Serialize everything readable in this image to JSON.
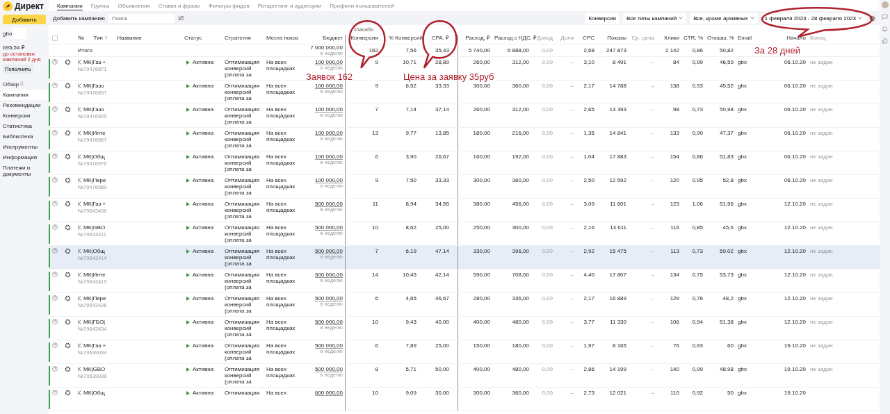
{
  "logo": "Директ",
  "nav_tabs": [
    {
      "label": "Кампании",
      "selected": true
    },
    {
      "label": "Группы",
      "selected": false
    },
    {
      "label": "Объявления",
      "selected": false
    },
    {
      "label": "Ставки и фразы",
      "selected": false
    },
    {
      "label": "Фильтры фидов",
      "selected": false
    },
    {
      "label": "Ретаргетинг и аудитории",
      "selected": false
    },
    {
      "label": "Профили пользователей",
      "selected": false
    }
  ],
  "sidebar": {
    "add_button": "Добавить",
    "account": "gbo",
    "balance": "695,54 ₽",
    "warning": "до остановки кампаний 2 дня",
    "topup_button": "Пополнить",
    "items": [
      {
        "label": "Обзор",
        "selected": false
      },
      {
        "label": "Кампании",
        "selected": true
      },
      {
        "label": "Рекомендации",
        "selected": false
      },
      {
        "label": "Конверсии",
        "selected": false
      },
      {
        "label": "Статистика",
        "selected": false
      },
      {
        "label": "Библиотека",
        "selected": false
      },
      {
        "label": "Инструменты",
        "selected": false
      },
      {
        "label": "Информация",
        "selected": false
      },
      {
        "label": "Платежи и документы",
        "selected": false
      }
    ]
  },
  "toolbar": {
    "add_campaign": "Добавить кампанию",
    "search": {
      "placeholder": "Поиск"
    },
    "filters": [
      {
        "label": "Конверсии",
        "kind": "button"
      },
      {
        "label": "Все типы кампаний",
        "kind": "dropdown"
      },
      {
        "label": "Все, кроме архивных",
        "kind": "dropdown"
      },
      {
        "label": "1 февраля 2023 - 28 февраля 2023",
        "kind": "dropdown"
      }
    ]
  },
  "table": {
    "goal": "спасибо",
    "columns": [
      "№",
      "Тип ↑",
      "Название",
      "Статус",
      "Стратегия",
      "Места показ",
      "Бюджет",
      "Конверсии",
      "% Конверсий",
      "CPA, ₽",
      "Расход, ₽",
      "Расход с НДС, ₽",
      "Доход",
      "Доля",
      "CPC",
      "Показы",
      "Ср. цена",
      "Клики",
      "CTR, %",
      "Отказы, %",
      "Email",
      "Начало",
      "Конец"
    ],
    "select_all": {
      "checked": false
    },
    "total": {
      "label": "Итого",
      "budget": "7 000 000,00",
      "budget_note": "в неделю",
      "conversions": "162",
      "conversion_rate": "7,56",
      "cpa": "35,43",
      "spend": "5 740,00",
      "spend_vat": "6 888,00",
      "income": "0,00",
      "cpc": "2,68",
      "impressions": "247 873",
      "clicks": "2 142",
      "ctr": "0,86",
      "bounce_rate": "50,82"
    },
    "rows": [
      {
        "name": "МК|Газ +",
        "number": "№79476871",
        "status": "Активна",
        "strategy": "Оптимизация конверсий (оплата за",
        "places": "На всех площадках",
        "budget": "100 000,00",
        "budget_note": "в неделю",
        "highlighted": false,
        "values": [
          "9",
          "10,71",
          "28,89",
          "260,00",
          "312,00",
          "0,00",
          "–",
          "3,10",
          "8 491",
          "–",
          "84",
          "0,99",
          "46,59",
          "gbx",
          "06.10.20",
          "не задан"
        ]
      },
      {
        "name": "МК|Газо",
        "number": "№79476897",
        "status": "Активна",
        "strategy": "Оптимизация конверсий (оплата за",
        "places": "На всех площадках",
        "budget": "100 000,00",
        "budget_note": "в неделю",
        "highlighted": false,
        "values": [
          "9",
          "6,52",
          "33,33",
          "300,00",
          "360,00",
          "0,00",
          "–",
          "2,17",
          "14 788",
          "–",
          "138",
          "0,93",
          "45,52",
          "gbx",
          "06.10.20",
          "не задан"
        ]
      },
      {
        "name": "МК|Газо",
        "number": "№79476925",
        "status": "Активна",
        "strategy": "Оптимизация конверсий (оплата за",
        "places": "На всех площадках",
        "budget": "100 000,00",
        "budget_note": "в неделю",
        "highlighted": false,
        "values": [
          "7",
          "7,14",
          "37,14",
          "260,00",
          "312,00",
          "0,00",
          "–",
          "2,65",
          "13 393",
          "–",
          "98",
          "0,73",
          "50,98",
          "gbx",
          "06.10.20",
          "не задан"
        ]
      },
      {
        "name": "МК|Инте",
        "number": "№79476957",
        "status": "Активна",
        "strategy": "Оптимизация конверсий (оплата за",
        "places": "На всех площадках",
        "budget": "100 000,00",
        "budget_note": "в неделю",
        "highlighted": false,
        "values": [
          "13",
          "9,77",
          "13,85",
          "180,00",
          "216,00",
          "0,00",
          "–",
          "1,35",
          "14 841",
          "–",
          "133",
          "0,90",
          "47,37",
          "gbx",
          "06.10.20",
          "не задан"
        ]
      },
      {
        "name": "МК|Общ",
        "number": "№79476976",
        "status": "Активна",
        "strategy": "Оптимизация конверсий (оплата за",
        "places": "На всех площадках",
        "budget": "100 000,00",
        "budget_note": "в неделю",
        "highlighted": false,
        "values": [
          "6",
          "3,90",
          "26,67",
          "160,00",
          "192,00",
          "0,00",
          "–",
          "1,04",
          "17 883",
          "–",
          "154",
          "0,86",
          "51,83",
          "gbx",
          "06.10.20",
          "не задан"
        ]
      },
      {
        "name": "МК|Пере",
        "number": "№79476989",
        "status": "Активна",
        "strategy": "Оптимизация конверсий (оплата за",
        "places": "На всех площадках",
        "budget": "100 000,00",
        "budget_note": "в неделю",
        "highlighted": false,
        "values": [
          "9",
          "7,50",
          "33,33",
          "300,00",
          "360,00",
          "0,00",
          "–",
          "2,50",
          "12 592",
          "–",
          "120",
          "0,95",
          "52,8",
          "gbx",
          "06.10.20",
          "не задан"
        ]
      },
      {
        "name": "МК|Газ +",
        "number": "№79643406",
        "status": "Активна",
        "strategy": "Оптимизация конверсий (оплата за",
        "places": "На всех площадках",
        "budget": "500 000,00",
        "budget_note": "в неделю",
        "highlighted": false,
        "values": [
          "11",
          "8,94",
          "34,55",
          "380,00",
          "456,00",
          "0,00",
          "–",
          "3,09",
          "11 601",
          "–",
          "123",
          "1,06",
          "51,56",
          "gbx",
          "12.10.20",
          "не задан"
        ]
      },
      {
        "name": "МК|GBO",
        "number": "№79643411",
        "status": "Активна",
        "strategy": "Оптимизация конверсий (оплата за",
        "places": "На всех площадках",
        "budget": "500 000,00",
        "budget_note": "в неделю",
        "highlighted": false,
        "values": [
          "10",
          "8,62",
          "25,00",
          "250,00",
          "300,00",
          "0,00",
          "–",
          "2,16",
          "13 611",
          "–",
          "116",
          "0,85",
          "45,6",
          "gbx",
          "12.10.20",
          "не задан"
        ]
      },
      {
        "name": "МК|Общ",
        "number": "№79643414",
        "status": "Активна",
        "strategy": "Оптимизация конверсий (оплата за",
        "places": "На всех площадках",
        "budget": "500 000,00",
        "budget_note": "в неделю",
        "highlighted": true,
        "values": [
          "7",
          "6,19",
          "47,14",
          "330,00",
          "396,00",
          "0,00",
          "–",
          "2,92",
          "15 475",
          "–",
          "113",
          "0,73",
          "59,02",
          "gbx",
          "12.10.20",
          "не задан"
        ]
      },
      {
        "name": "МК|Инте",
        "number": "№79643419",
        "status": "Активна",
        "strategy": "Оптимизация конверсий (оплата за",
        "places": "На всех площадках",
        "budget": "500 000,00",
        "budget_note": "в неделю",
        "highlighted": false,
        "values": [
          "14",
          "10,45",
          "42,14",
          "590,00",
          "708,00",
          "0,00",
          "–",
          "4,40",
          "17 807",
          "–",
          "134",
          "0,75",
          "53,73",
          "gbx",
          "12.10.20",
          "не задан"
        ]
      },
      {
        "name": "МК|Пере",
        "number": "№79643426",
        "status": "Активна",
        "strategy": "Оптимизация конверсий (оплата за",
        "places": "На всех площадках",
        "budget": "500 000,00",
        "budget_note": "в неделю",
        "highlighted": false,
        "values": [
          "6",
          "4,65",
          "46,67",
          "280,00",
          "336,00",
          "0,00",
          "–",
          "2,17",
          "16 889",
          "–",
          "129",
          "0,76",
          "48,2",
          "gbx",
          "12.10.20",
          "не задан"
        ]
      },
      {
        "name": "МК|ГБО|",
        "number": "№79643434",
        "status": "Активна",
        "strategy": "Оптимизация конверсий (оплата за",
        "places": "На всех площадках",
        "budget": "500 000,00",
        "budget_note": "в неделю",
        "highlighted": false,
        "values": [
          "10",
          "9,43",
          "40,00",
          "400,00",
          "480,00",
          "0,00",
          "–",
          "3,77",
          "11 330",
          "–",
          "106",
          "0,94",
          "51,38",
          "gbx",
          "12.10.20",
          "не задан"
        ]
      },
      {
        "name": "МК|Газ +",
        "number": "№79639034",
        "status": "Активна",
        "strategy": "Оптимизация конверсий (оплата за",
        "places": "На всех площадках",
        "budget": "500 000,00",
        "budget_note": "в неделю",
        "highlighted": false,
        "values": [
          "6",
          "7,89",
          "25,00",
          "150,00",
          "180,00",
          "0,00",
          "–",
          "1,97",
          "8 165",
          "–",
          "76",
          "0,93",
          "60",
          "gbx",
          "19.10.20",
          "не задан"
        ]
      },
      {
        "name": "МК|GBO",
        "number": "№79639038",
        "status": "Активна",
        "strategy": "Оптимизация конверсий (оплата за",
        "places": "На всех площадках",
        "budget": "500 000,00",
        "budget_note": "в неделю",
        "highlighted": false,
        "values": [
          "8",
          "5,71",
          "50,00",
          "400,00",
          "480,00",
          "0,00",
          "–",
          "2,86",
          "14 199",
          "–",
          "140",
          "0,99",
          "48,98",
          "gbx",
          "19.10.20",
          "не задан"
        ]
      },
      {
        "name": "МК|Общ",
        "status": "Активна",
        "strategy": "Оптимизация",
        "places": "На всех",
        "budget": "600 000,00",
        "highlighted": false,
        "values": [
          "10",
          "9,09",
          "30,00",
          "300,00",
          "360,00",
          "0,00",
          "–",
          "2,73",
          "12 021",
          "–",
          "110",
          "0,92",
          "50",
          "gbx",
          "19.10.20"
        ]
      }
    ]
  },
  "annotations": [
    {
      "kind": "conversions",
      "text": "Заявок 162"
    },
    {
      "kind": "cpa",
      "text": "Цена за заявку 35руб"
    },
    {
      "kind": "period",
      "text": "За 28 дней"
    }
  ]
}
